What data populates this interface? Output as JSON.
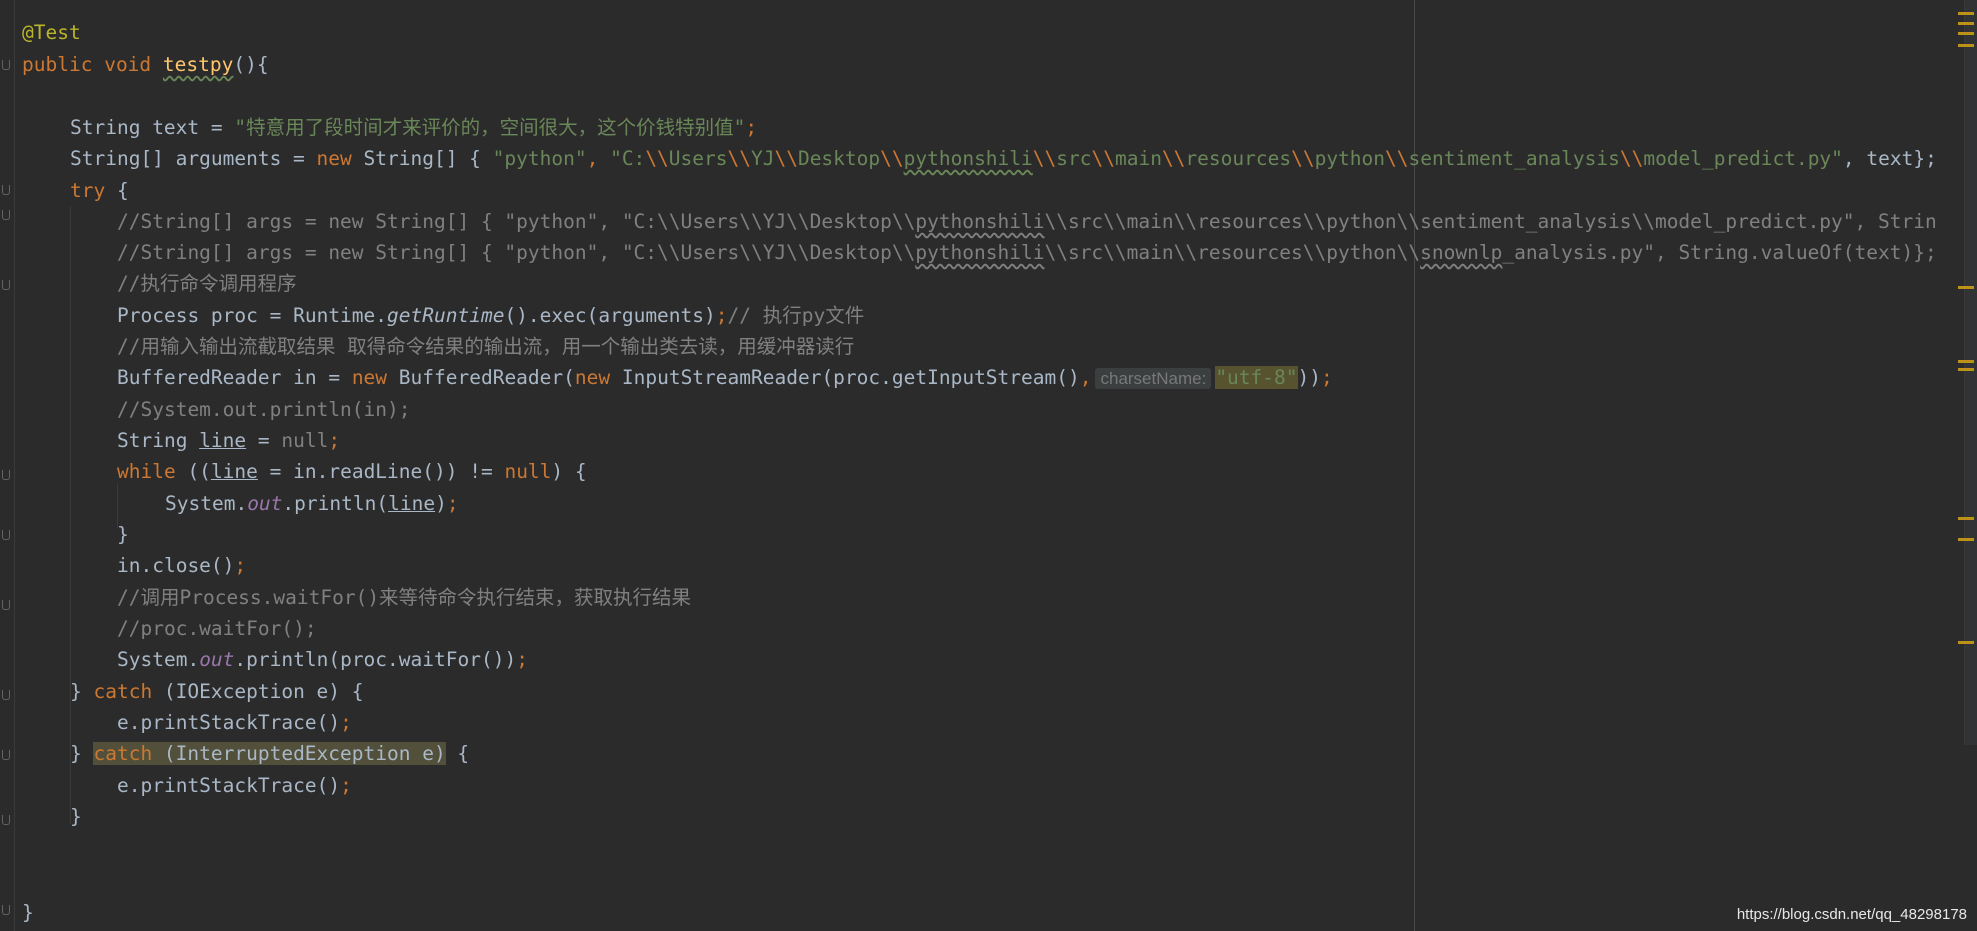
{
  "editor": {
    "annotation": "@Test",
    "kw_public": "public",
    "kw_void": "void",
    "method_name": "testpy",
    "method_tail": "(){",
    "line_text": {
      "type": "String",
      "mid": " text = ",
      "value": "\"特意用了段时间才来评价的，空间很大，这个价钱特别值\"",
      "semi": ";"
    },
    "line_args": {
      "prefix": "String[] arguments = ",
      "kw_new": "new",
      "mid": " String[] { ",
      "s1": "\"python\"",
      "comma1": ", ",
      "s2a": "\"C:",
      "esc": "\\\\",
      "users": "Users",
      "yj": "YJ",
      "desktop": "Desktop",
      "pythonshili": "pythonshili",
      "src": "src",
      "main": "main",
      "resources": "resources",
      "python": "python",
      "sentiment": "sentiment_analysis",
      "model": "model_predict.py\"",
      "tail": ", text};"
    },
    "kw_try": "try",
    "brace_open": " {",
    "comment_args1_a": "//String[] args = new String[] { \"python\", \"C:\\\\Users\\\\YJ\\\\Desktop\\\\",
    "comment_args1_b": "pythonshili",
    "comment_args1_c": "\\\\src\\\\main\\\\resources\\\\python\\\\sentiment_analysis\\\\model_predict.py\", Strin",
    "comment_args2_a": "//String[] args = new String[] { \"python\", \"C:\\\\Users\\\\YJ\\\\Desktop\\\\",
    "comment_args2_b": "pythonshili",
    "comment_args2_c": "\\\\src\\\\main\\\\resources\\\\python\\\\",
    "comment_args2_d": "snownlp",
    "comment_args2_e": "_analysis.py\", String.valueOf(text)};",
    "comment_exec": "//执行命令调用程序",
    "proc_a": "Process proc = Runtime.",
    "proc_getruntime": "getRuntime",
    "proc_b": "().exec(arguments)",
    "proc_semi": ";",
    "proc_comment": "// 执行py文件",
    "comment_read": "//用输入输出流截取结果 取得命令结果的输出流，用一个输出类去读，用缓冲器读行",
    "br_a": "BufferedReader in = ",
    "br_new1": "new",
    "br_b": " BufferedReader(",
    "br_new2": "new",
    "br_c": " InputStreamReader(proc.getInputStream()",
    "br_comma": ",",
    "br_hint": "charsetName:",
    "br_charset": "\"utf-8\"",
    "br_tail": "))",
    "br_semi": ";",
    "comment_println_in": "//System.out.println(in);",
    "line_decl_a": "String ",
    "line_var": "line",
    "line_decl_b": " = ",
    "kw_null": "null",
    "semi": ";",
    "kw_while": "while",
    "while_a": " ((",
    "while_var": "line",
    "while_b": " = in.readLine()) != ",
    "while_null": "null",
    "while_c": ") {",
    "sys_a": "System.",
    "sys_out": "out",
    "sys_b": ".println(",
    "sys_var": "line",
    "sys_c": ")",
    "brace_close": "}",
    "close_stmt": "in.close()",
    "comment_waitfor": "//调用Process.waitFor()来等待命令执行结束，获取执行结果",
    "comment_proc_waitfor": "//proc.waitFor();",
    "wait_a": "System.",
    "wait_out": "out",
    "wait_b": ".println(proc.waitFor())",
    "catch1_a": "} ",
    "kw_catch": "catch",
    "catch1_b": " (IOException e) {",
    "print_stack": "e.printStackTrace()",
    "catch2_b": " (InterruptedException e)",
    "catch2_c": " {"
  },
  "watermark": "https://blog.csdn.net/qq_48298178"
}
